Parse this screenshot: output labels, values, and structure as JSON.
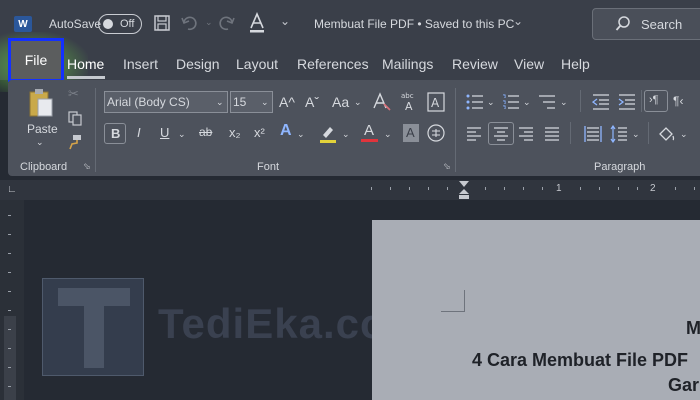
{
  "titlebar": {
    "app_logo": "W",
    "autosave_label": "AutoSave",
    "autosave_state": "Off",
    "doc_title": "Membuat File PDF • Saved to this PC",
    "search_placeholder": "Search",
    "icons": [
      "save-icon",
      "undo-icon",
      "redo-icon",
      "font-color-icon",
      "customize-icon",
      "search-icon"
    ]
  },
  "tabs": [
    "File",
    "Home",
    "Insert",
    "Design",
    "Layout",
    "References",
    "Mailings",
    "Review",
    "View",
    "Help"
  ],
  "ribbon": {
    "clipboard": {
      "paste_label": "Paste",
      "group_label": "Clipboard"
    },
    "font": {
      "font_name": "Arial (Body CS)",
      "font_size": "15",
      "grow_font": "A^",
      "shrink_font": "Aˇ",
      "change_case": "Aa",
      "bold": "B",
      "italic": "I",
      "underline": "U",
      "strikethrough": "ab",
      "subscript": "x₂",
      "superscript": "x²",
      "text_effects": "A",
      "font_color": "A",
      "char_shading": "A",
      "group_label": "Font"
    },
    "paragraph": {
      "group_label": "Paragraph"
    }
  },
  "ruler": {
    "numbers": [
      "1",
      "2"
    ]
  },
  "document": {
    "line1": "M",
    "heading": "4 Cara Membuat File PDF",
    "heading_line2": "Gar"
  },
  "watermark": {
    "text": "TediEka.com"
  },
  "colors": {
    "highlight_border": "#1330ff",
    "file_glow": "#64be46",
    "highlight_underline": "#e2d23a",
    "font_color_underline": "#e0343c"
  }
}
